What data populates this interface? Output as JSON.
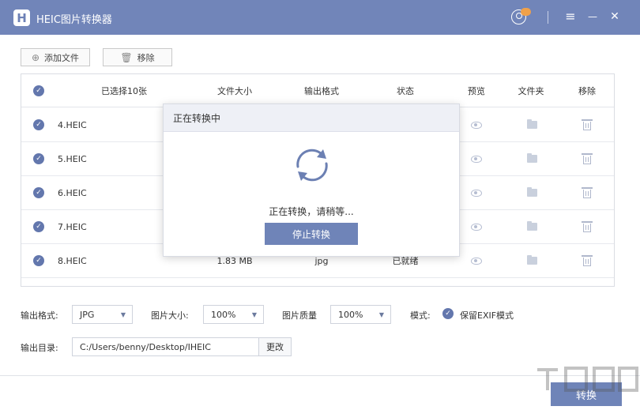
{
  "app": {
    "title": "HEIC图片转换器",
    "logo_letter": "H"
  },
  "titlebar": {
    "menu_glyph": "≡",
    "minimize_glyph": "—",
    "close_glyph": "✕"
  },
  "toolbar": {
    "add_label": "添加文件",
    "remove_label": "移除"
  },
  "table": {
    "headers": {
      "selected": "已选择10张",
      "size": "文件大小",
      "format": "输出格式",
      "status": "状态",
      "preview": "预览",
      "folder": "文件夹",
      "remove": "移除"
    },
    "rows": [
      {
        "name": "4.HEIC",
        "size": "",
        "format": "",
        "status": ""
      },
      {
        "name": "5.HEIC",
        "size": "",
        "format": "",
        "status": ""
      },
      {
        "name": "6.HEIC",
        "size": "",
        "format": "",
        "status": ""
      },
      {
        "name": "7.HEIC",
        "size": "",
        "format": "",
        "status": ""
      },
      {
        "name": "8.HEIC",
        "size": "1.83 MB",
        "format": "jpg",
        "status": "已就绪"
      }
    ]
  },
  "dialog": {
    "title": "正在转换中",
    "message": "正在转换，请稍等...",
    "stop_label": "停止转换"
  },
  "settings": {
    "format_label": "输出格式:",
    "format_value": "JPG",
    "size_label": "图片大小:",
    "size_value": "100%",
    "quality_label": "图片质量",
    "quality_value": "100%",
    "mode_label": "模式:",
    "exif_label": "保留EXIF模式",
    "output_dir_label": "输出目录:",
    "output_dir_value": "C:/Users/benny/Desktop/IHEIC",
    "change_label": "更改"
  },
  "footer": {
    "convert_label": "转换"
  },
  "colors": {
    "titlebar": "#7185b9",
    "accent": "#6f84b8",
    "check": "#6377ad"
  }
}
